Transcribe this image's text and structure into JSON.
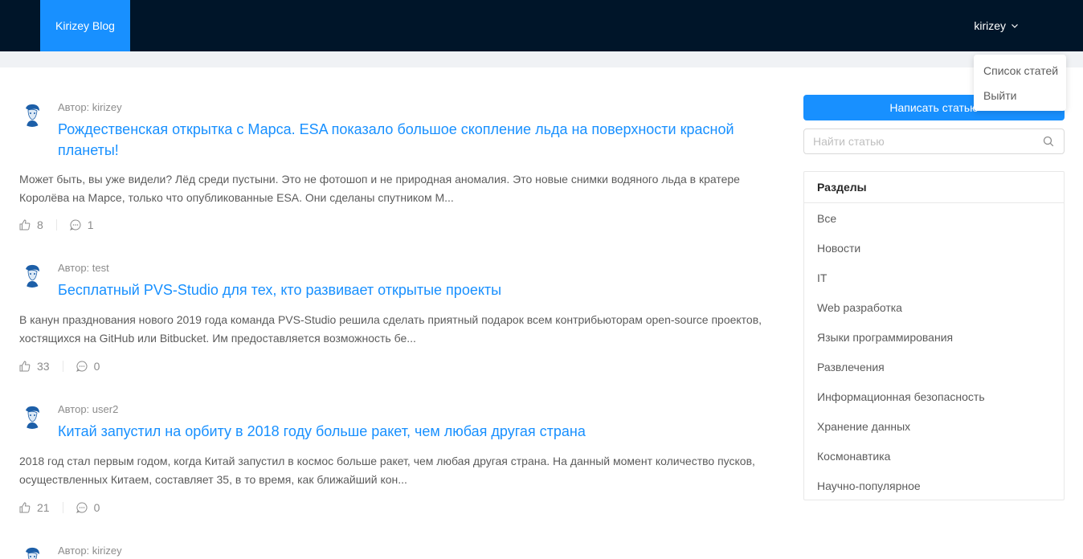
{
  "header": {
    "logo": "Kirizey Blog",
    "username": "kirizey"
  },
  "dropdown": {
    "items": [
      {
        "label": "Список статей"
      },
      {
        "label": "Выйти"
      }
    ]
  },
  "articles": [
    {
      "author": "Автор: kirizey",
      "title": "Рождественская открытка с Марса. ESA показало большое скопление льда на поверхности красной планеты!",
      "description": "Может быть, вы уже видели? Лёд среди пустыни. Это не фотошоп и не природная аномалия. Это новые снимки водяного льда в кратере Королёва на Марсе, только что опубликованные ESA. Они сделаны спутником M...",
      "likes": "8",
      "comments": "1"
    },
    {
      "author": "Автор: test",
      "title": "Бесплатный PVS-Studio для тех, кто развивает открытые проекты",
      "description": "В канун празднования нового 2019 года команда PVS-Studio решила сделать приятный подарок всем контрибьюторам open-source проектов, хостящихся на GitHub или Bitbucket. Им предоставляется возможность бе...",
      "likes": "33",
      "comments": "0"
    },
    {
      "author": "Автор: user2",
      "title": "Китай запустил на орбиту в 2018 году больше ракет, чем любая другая страна",
      "description": "2018 год стал первым годом, когда Китай запустил в космос больше ракет, чем любая другая страна. На данный момент количество пусков, осуществленных Китаем, составляет 35, в то время, как ближайший кон...",
      "likes": "21",
      "comments": "0"
    },
    {
      "author": "Автор: kirizey"
    }
  ],
  "sidebar": {
    "write_button": "Написать статью",
    "search_placeholder": "Найти статью",
    "sections_title": "Разделы",
    "sections": [
      {
        "label": "Все"
      },
      {
        "label": "Новости"
      },
      {
        "label": "IT"
      },
      {
        "label": "Web разработка"
      },
      {
        "label": "Языки программирования"
      },
      {
        "label": "Развлечения"
      },
      {
        "label": "Информационная безопасность"
      },
      {
        "label": "Хранение данных"
      },
      {
        "label": "Космонавтика"
      },
      {
        "label": "Научно-популярное"
      }
    ]
  },
  "colors": {
    "header_bg": "#001529",
    "accent": "#1890ff"
  },
  "icons": {
    "like": "like-icon",
    "comment": "message-icon",
    "search": "search-icon",
    "dropdown": "chevron-down-icon",
    "avatar": "user-avatar"
  }
}
